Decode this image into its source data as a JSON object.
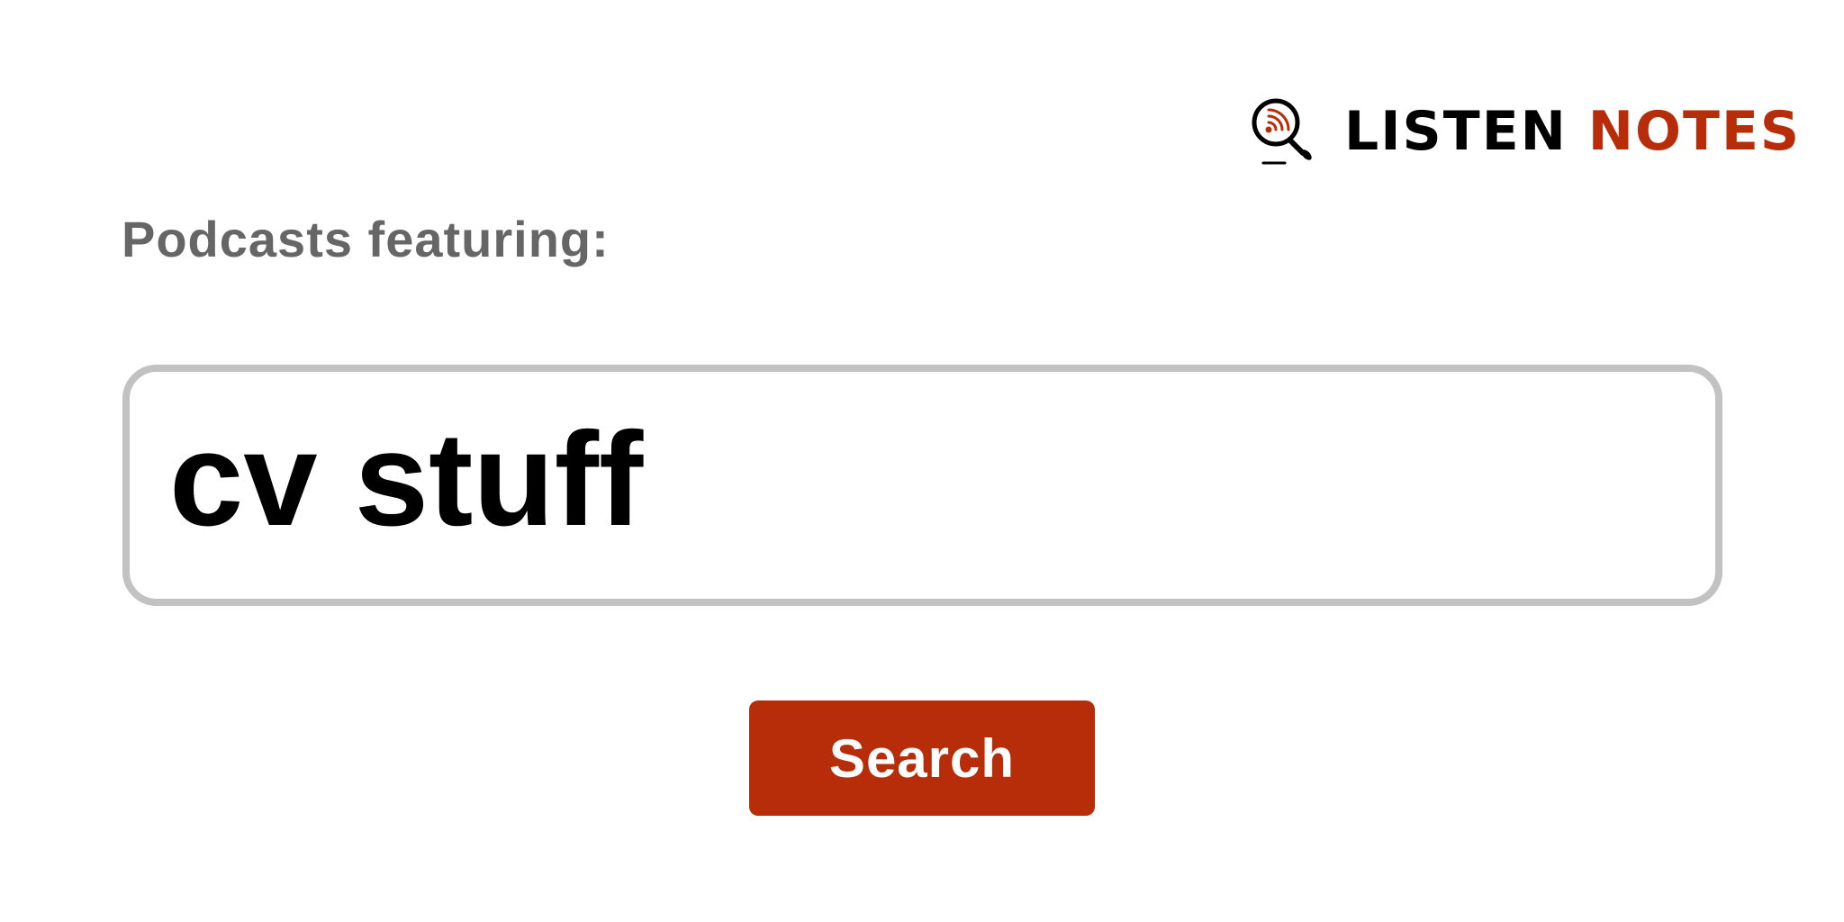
{
  "brand": {
    "word1": "LISTEN",
    "word2": "NOTES",
    "icon": "podcast-magnifier-icon",
    "accent_color": "#b72d0a"
  },
  "heading": {
    "text": "Podcasts featuring:"
  },
  "search": {
    "value": "cv stuff",
    "button_label": "Search"
  }
}
